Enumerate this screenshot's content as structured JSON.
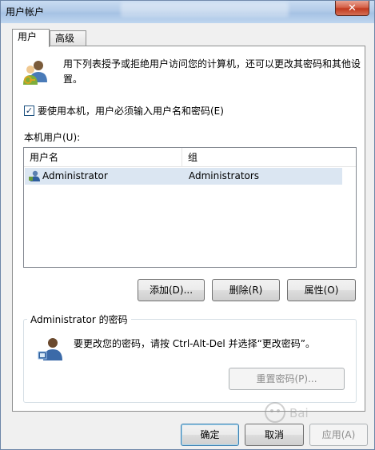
{
  "window": {
    "title": "用户帐户",
    "close_label": "✕"
  },
  "tabs": [
    {
      "label": "用户",
      "active": true
    },
    {
      "label": "高级",
      "active": false
    }
  ],
  "description": "用下列表授予或拒绝用户访问您的计算机，还可以更改其密码和其他设置。",
  "require_login": {
    "label": "要使用本机，用户必须输入用户名和密码(E)",
    "checked": true
  },
  "local_users": {
    "label": "本机用户(U):",
    "columns": [
      "用户名",
      "组"
    ],
    "rows": [
      {
        "name": "Administrator",
        "group": "Administrators",
        "icon": "user-icon"
      }
    ]
  },
  "user_buttons": {
    "add": "添加(D)...",
    "remove": "删除(R)",
    "properties": "属性(O)"
  },
  "password_group": {
    "legend": "Administrator 的密码",
    "text": "要更改您的密码，请按 Ctrl-Alt-Del 并选择“更改密码”。",
    "reset_button": "重置密码(P)...",
    "icon": "user-key-icon"
  },
  "footer": {
    "ok": "确定",
    "cancel": "取消",
    "apply": "应用(A)"
  },
  "colors": {
    "accent": "#3c7fb1",
    "selection": "#dbe6f2",
    "titlebar": "#b2cbe8",
    "close": "#c13a1f"
  }
}
